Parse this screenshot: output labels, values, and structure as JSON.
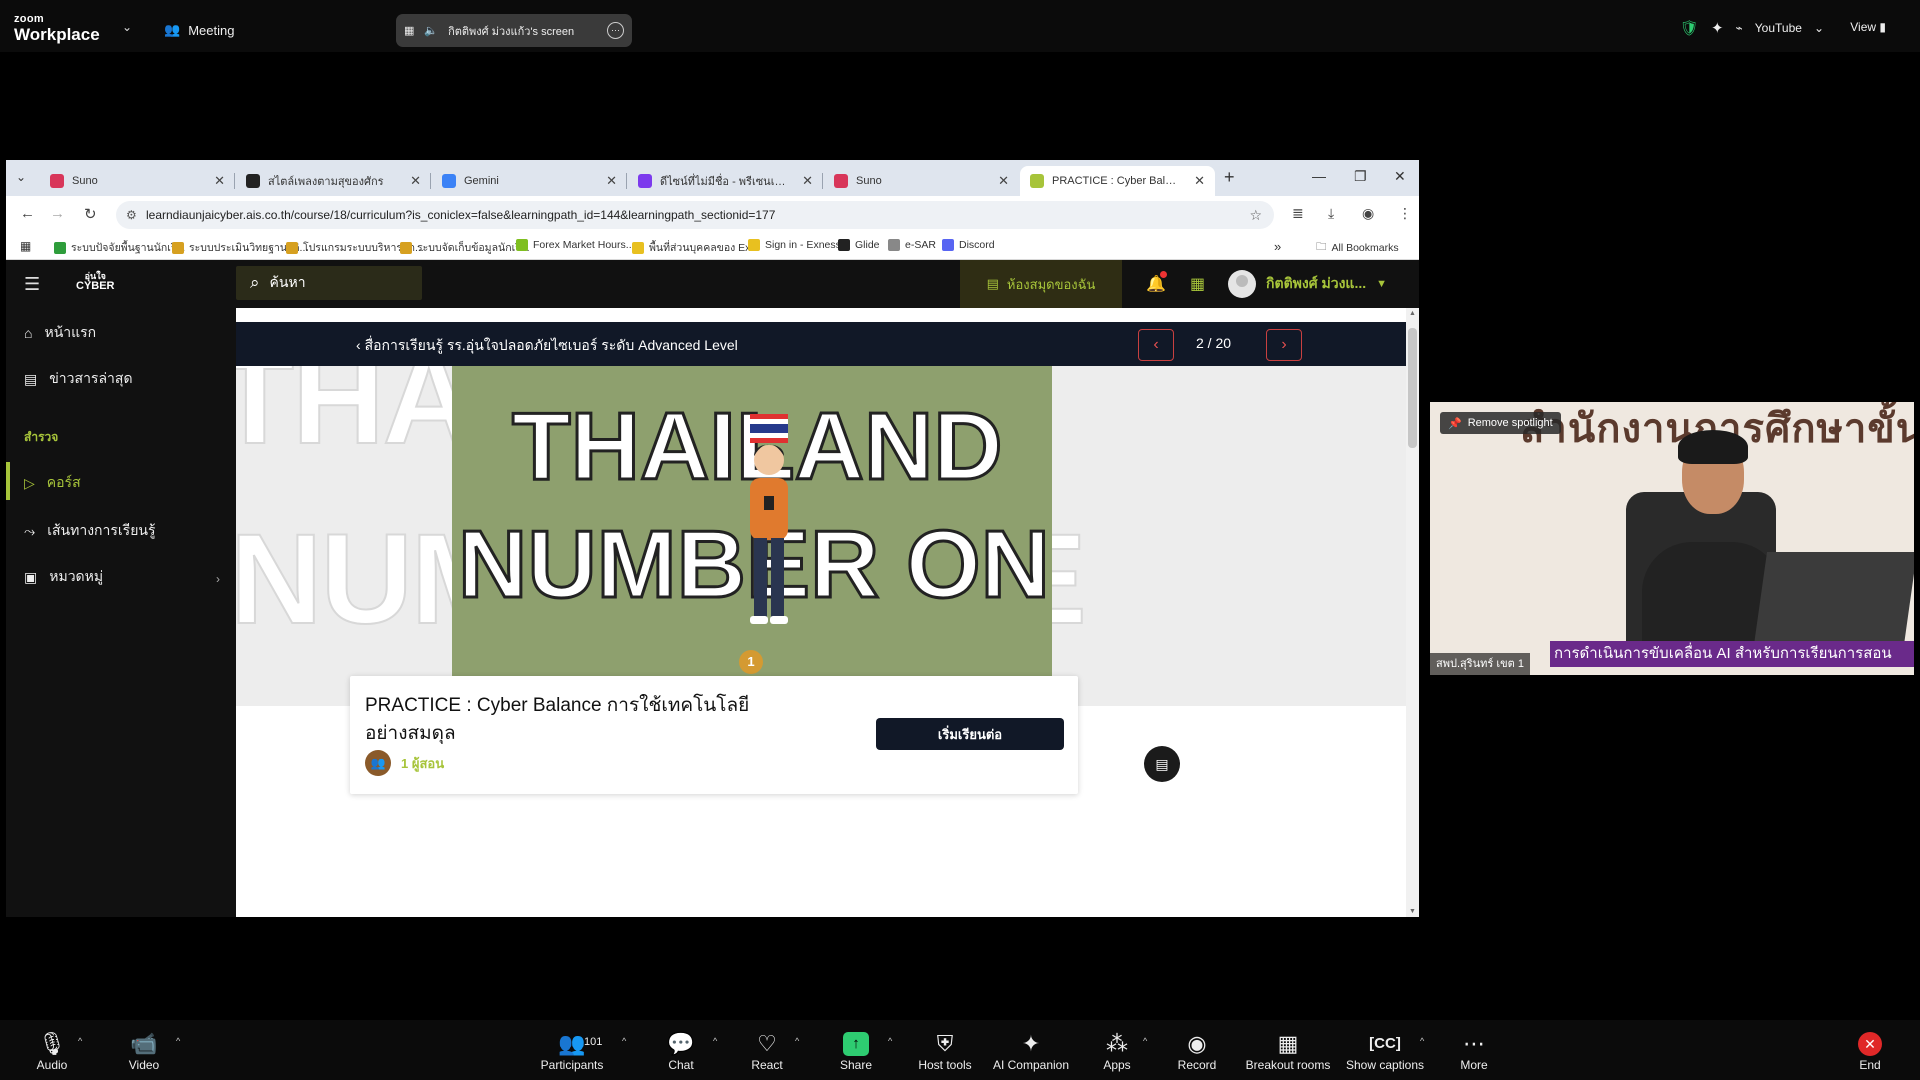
{
  "zoom_top": {
    "logo_small": "zoom",
    "logo_big": "Workplace",
    "meeting_label": "Meeting",
    "share_label": "กิตติพงศ์ ม่วงแก้ว's screen",
    "youtube_label": "YouTube",
    "view_label": "View"
  },
  "browser": {
    "tabs": [
      {
        "title": "Suno",
        "color": "#d8365a"
      },
      {
        "title": "สไตล์เพลงตามสุของศักร",
        "color": "#222222"
      },
      {
        "title": "Gemini",
        "color": "#3b82f6"
      },
      {
        "title": "ดีไซน์ที่ไม่มีชื่อ - พรีเซนเทชั่น",
        "color": "#7c3aed"
      },
      {
        "title": "Suno",
        "color": "#d8365a"
      },
      {
        "title": "PRACTICE : Cyber Balance",
        "color": "#a7c43a"
      }
    ],
    "url": "learndiaunjaicyber.ais.co.th/course/18/curriculum?is_coniclex=false&learningpath_id=144&learningpath_sectionid=177",
    "bookmarks": [
      {
        "label": "ระบบปัจจัยพื้นฐานนักเรี...",
        "color": "#2e9d3b"
      },
      {
        "label": "ระบบประเมินวิทยฐานะดิ...",
        "color": "#d6a020"
      },
      {
        "label": "โปรแกรมระบบบริหารจัด...",
        "color": "#d6a020"
      },
      {
        "label": "ระบบจัดเก็บข้อมูลนักเรี...",
        "color": "#d6a020"
      },
      {
        "label": "Forex Market Hours...",
        "color": "#7fbf20"
      },
      {
        "label": "พื้นที่ส่วนบุคคลของ Ex...",
        "color": "#e8c020"
      },
      {
        "label": "Sign in - Exness",
        "color": "#e8c020"
      },
      {
        "label": "Glide",
        "color": "#222222"
      },
      {
        "label": "e-SAR",
        "color": "#888888"
      },
      {
        "label": "Discord",
        "color": "#5865f2"
      }
    ],
    "more_bookmarks": "»",
    "all_bookmarks": "All Bookmarks"
  },
  "site": {
    "logo_line1": "อุ่นใจ",
    "logo_line2": "CYBER",
    "search_placeholder": "ค้นหา",
    "library_label": "ห้องสมุดของฉัน",
    "user_name": "กิตติพงศ์ ม่วงแ...",
    "sidebar": {
      "home": "หน้าแรก",
      "news": "ข่าวสารล่าสุด",
      "section": "สำรวจ",
      "courses": "คอร์ส",
      "learning_path": "เส้นทางการเรียนรู้",
      "categories": "หมวดหมู่"
    },
    "course_bar": {
      "back_label": "สื่อการเรียนรู้ รร.อุ่นใจปลอดภัยไซเบอร์ ระดับ Advanced Level",
      "pager": "2 / 20"
    },
    "video": {
      "line1": "THAILAND",
      "line2": "NUMBER ONE",
      "badge": "1"
    },
    "card": {
      "title": "PRACTICE : Cyber Balance การใช้เทคโนโลยีอย่างสมดุล",
      "trainer": "1 ผู้สอน",
      "start_button": "เริ่มเรียนต่อ"
    }
  },
  "speaker": {
    "spotlight_label": "Remove spotlight",
    "banner": "สำนักงานการศึกษาขั้นพื้นฐาน",
    "name_tag": "สพป.สุรินทร์ เขต 1",
    "ticker": "การดำเนินการขับเคลื่อน AI สำหรับการเรียนการสอน"
  },
  "toolbar": {
    "audio": "Audio",
    "video": "Video",
    "participants": "Participants",
    "participants_count": "101",
    "chat": "Chat",
    "react": "React",
    "share": "Share",
    "host_tools": "Host tools",
    "ai_companion": "AI Companion",
    "apps": "Apps",
    "record": "Record",
    "breakout": "Breakout rooms",
    "captions": "Show captions",
    "more": "More",
    "end": "End"
  }
}
